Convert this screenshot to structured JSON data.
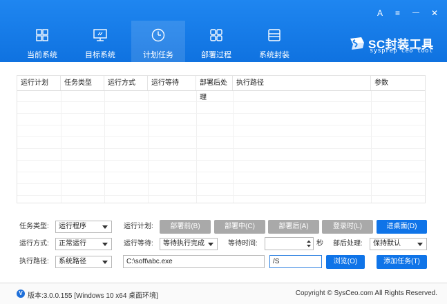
{
  "window": {
    "controls": {
      "profile": "A",
      "menu": "≡",
      "minimize": "—",
      "close": "✕"
    }
  },
  "nav": [
    {
      "label": "当前系统",
      "icon": "windows-icon"
    },
    {
      "label": "目标系统",
      "icon": "monitor-icon"
    },
    {
      "label": "计划任务",
      "icon": "clock-icon",
      "active": true
    },
    {
      "label": "部署过程",
      "icon": "grid-icon"
    },
    {
      "label": "系统封装",
      "icon": "disk-icon"
    }
  ],
  "logo": {
    "title": "SC封装工具",
    "subtitle": "sysprep ceo tool"
  },
  "table": {
    "headers": [
      "运行计划",
      "任务类型",
      "运行方式",
      "运行等待",
      "部署后处理",
      "执行路径",
      "参数"
    ]
  },
  "form": {
    "task_type_label": "任务类型:",
    "task_type_value": "运行程序",
    "run_mode_label": "运行方式:",
    "run_mode_value": "正常运行",
    "exec_path_label": "执行路径:",
    "exec_path_value": "系统路径",
    "run_plan_label": "运行计划:",
    "run_wait_label": "运行等待:",
    "run_wait_value": "等待执行完成",
    "wait_time_label": "等待时间:",
    "wait_time_value": "",
    "seconds_label": "秒",
    "post_process_label": "部后处理:",
    "post_process_value": "保持默认",
    "path_input_value": "C:\\soft\\abc.exe",
    "param_input_value": "/S",
    "plan_buttons": [
      "部署前(B)",
      "部署中(C)",
      "部署后(A)",
      "登录时(L)",
      "进桌面(D)"
    ],
    "browse_button": "浏览(O)",
    "add_task_button": "添加任务(T)"
  },
  "footer": {
    "version_icon": "V",
    "version": "版本:3.0.0.155 [Windows 10 x64 桌面环境]",
    "copyright": "Copyright © SysCeo.com All Rights Reserved."
  },
  "colors": {
    "header": "#1a80ec",
    "primary_button": "#0f74e8",
    "inactive_button": "#a9a9a9"
  }
}
